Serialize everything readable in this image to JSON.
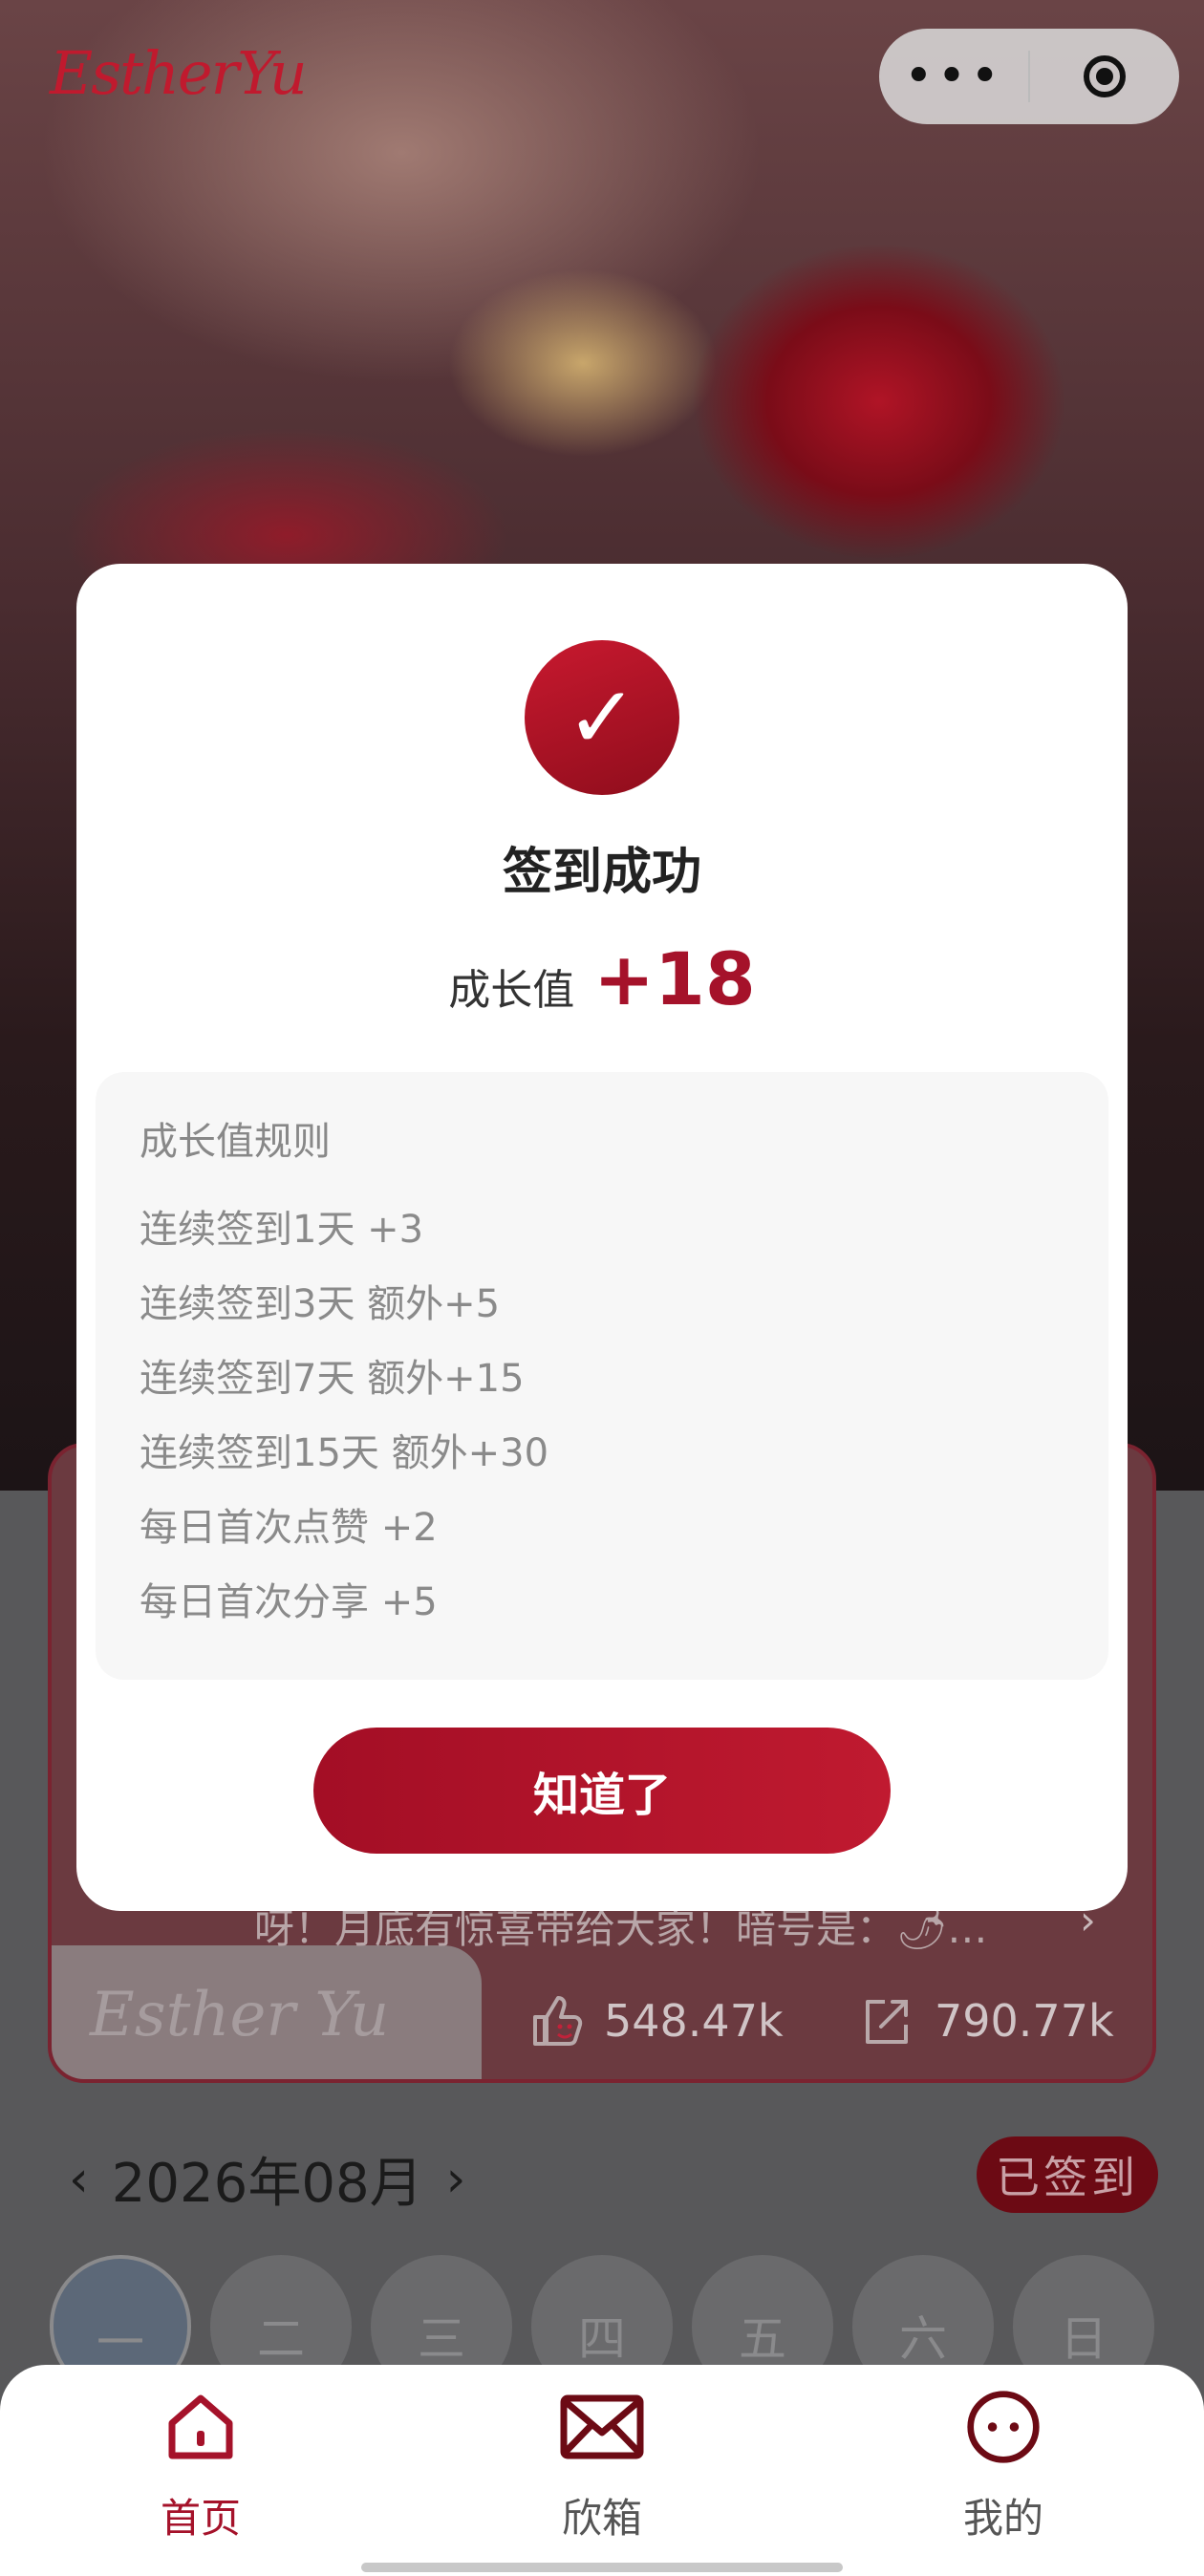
{
  "header": {
    "logo": "EstherYu",
    "capsule_more": "•••"
  },
  "card": {
    "brand": "Esther Yu",
    "description": "呀！月底有惊喜带给大家！暗号是：🌶…",
    "likes": "548.47k",
    "shares": "790.77k"
  },
  "calendar": {
    "prev": "‹",
    "month": "2026年08月",
    "next": "›",
    "signed_badge": "已签到",
    "weekdays": [
      "一",
      "二",
      "三",
      "四",
      "五",
      "六",
      "日"
    ]
  },
  "modal": {
    "check": "✓",
    "title": "签到成功",
    "growth_label": "成长值",
    "growth_value": "+18",
    "rules_title": "成长值规则",
    "rules": [
      "连续签到1天 +3",
      "连续签到3天 额外+5",
      "连续签到7天 额外+15",
      "连续签到15天 额外+30",
      "每日首次点赞 +2",
      "每日首次分享 +5"
    ],
    "confirm": "知道了"
  },
  "tabbar": {
    "items": [
      {
        "label": "首页",
        "active": true
      },
      {
        "label": "欣箱",
        "active": false
      },
      {
        "label": "我的",
        "active": false
      }
    ]
  },
  "colors": {
    "accent": "#a5122a",
    "accent_dark": "#6c0a14"
  }
}
